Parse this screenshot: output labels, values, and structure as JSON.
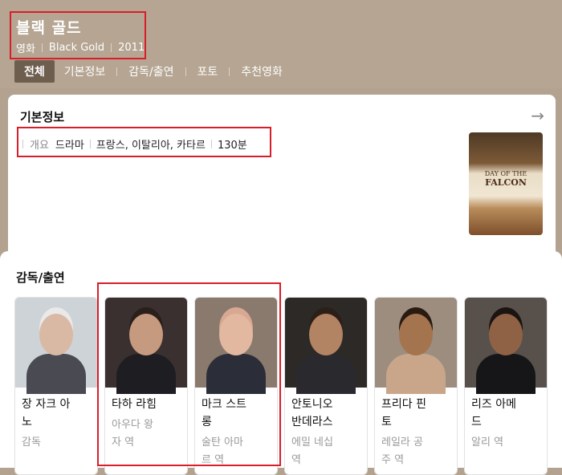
{
  "header": {
    "title": "블랙 골드",
    "genre": "영화",
    "original_title": "Black Gold",
    "year": "2011"
  },
  "tabs": [
    {
      "label": "전체",
      "active": true
    },
    {
      "label": "기본정보"
    },
    {
      "label": "감독/출연"
    },
    {
      "label": "포토"
    },
    {
      "label": "추천영화"
    }
  ],
  "basic_info": {
    "section_title": "기본정보",
    "summary_label": "개요",
    "genre": "드라마",
    "countries": "프랑스, 이탈리아, 카타르",
    "runtime": "130분",
    "poster": {
      "line1": "DAY OF THE",
      "line2": "FALCON"
    }
  },
  "cast_section": {
    "section_title": "감독/출연",
    "people": [
      {
        "name_lines": [
          "장 자크 아",
          "노"
        ],
        "role_lines": [
          "감독"
        ]
      },
      {
        "name_lines": [
          "타하 라힘"
        ],
        "role_lines": [
          "아우다 왕",
          "자 역"
        ]
      },
      {
        "name_lines": [
          "마크 스트",
          "롱"
        ],
        "role_lines": [
          "술탄 아마",
          "르 역"
        ]
      },
      {
        "name_lines": [
          "안토니오",
          "반데라스"
        ],
        "role_lines": [
          "에밀 네십",
          "역"
        ]
      },
      {
        "name_lines": [
          "프리다 핀",
          "토"
        ],
        "role_lines": [
          "레일라 공",
          "주 역"
        ]
      },
      {
        "name_lines": [
          "리즈 아메",
          "드"
        ],
        "role_lines": [
          "알리 역"
        ]
      }
    ]
  }
}
